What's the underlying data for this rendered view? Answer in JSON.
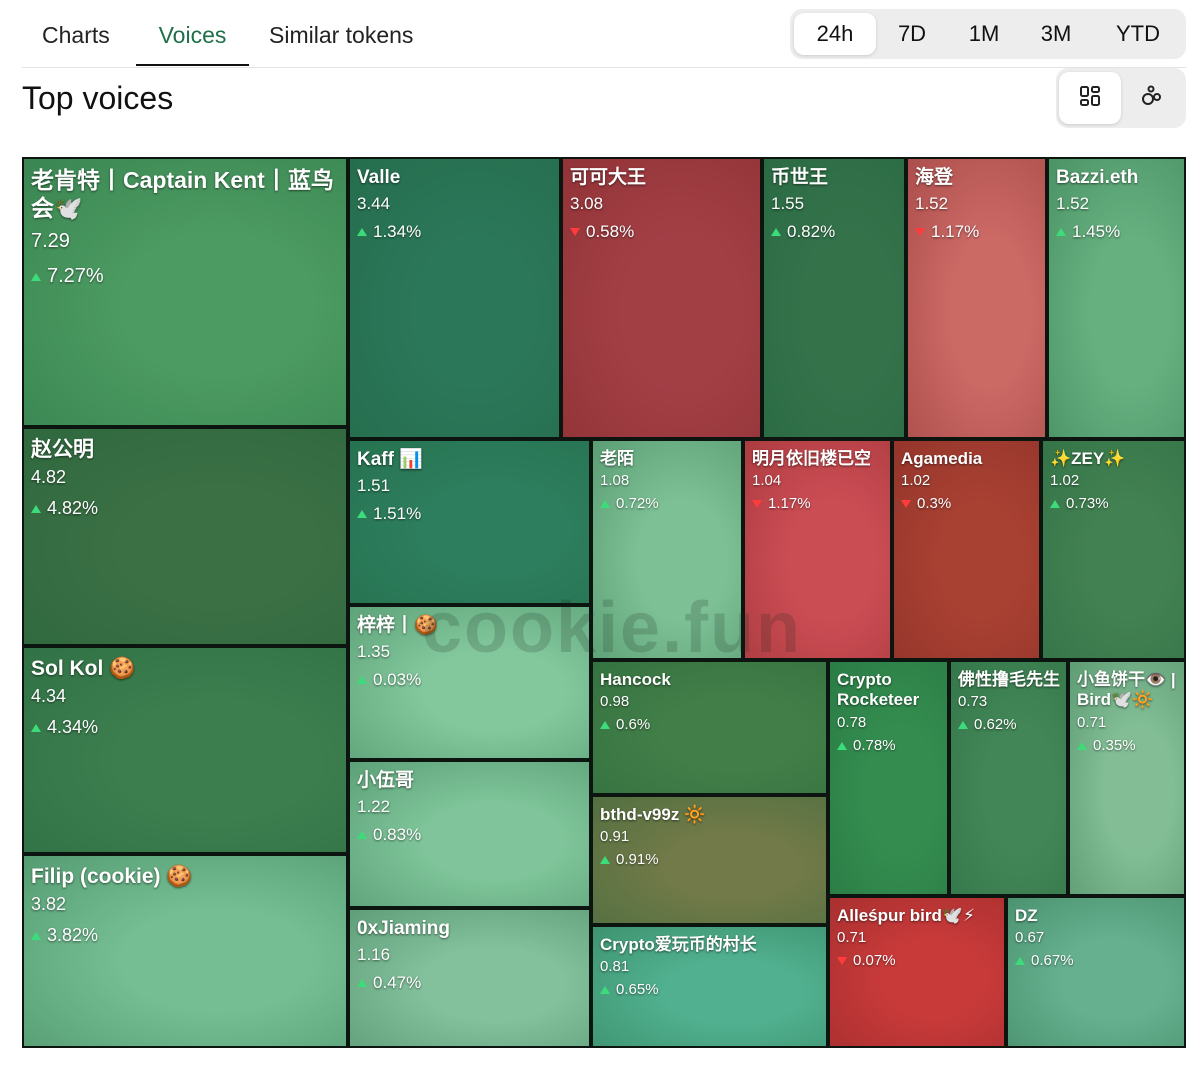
{
  "tabs": [
    {
      "label": "Charts"
    },
    {
      "label": "Voices"
    },
    {
      "label": "Similar tokens"
    }
  ],
  "time_ranges": [
    {
      "label": "24h"
    },
    {
      "label": "7D"
    },
    {
      "label": "1M"
    },
    {
      "label": "3M"
    },
    {
      "label": "YTD"
    }
  ],
  "title": "Top voices",
  "watermark": "cookie.fun",
  "voices": [
    {
      "name": "老肯特丨Captain Kent丨蓝鸟会🕊️",
      "score": "7.29",
      "change": "7.27%",
      "dir": "up",
      "art": "#6f8a64"
    },
    {
      "name": "赵公明",
      "score": "4.82",
      "change": "4.82%",
      "dir": "up",
      "art": "#4a2a22"
    },
    {
      "name": "Sol Kol 🍪",
      "score": "4.34",
      "change": "4.34%",
      "dir": "up",
      "art": "#4e4a3a"
    },
    {
      "name": "Filip (cookie) 🍪",
      "score": "3.82",
      "change": "3.82%",
      "dir": "up",
      "art": "#c9d6d0"
    },
    {
      "name": "Valle",
      "score": "3.44",
      "change": "1.34%",
      "dir": "up",
      "art": "#273a52"
    },
    {
      "name": "可可大王",
      "score": "3.08",
      "change": "0.58%",
      "dir": "down",
      "art": "#6e4c5a"
    },
    {
      "name": "币世王",
      "score": "1.55",
      "change": "0.82%",
      "dir": "up",
      "art": "#3a3030"
    },
    {
      "name": "海登",
      "score": "1.52",
      "change": "1.17%",
      "dir": "down",
      "art": "#c8a8a0"
    },
    {
      "name": "Bazzi.eth",
      "score": "1.52",
      "change": "1.45%",
      "dir": "up",
      "art": "#a8b8a6"
    },
    {
      "name": "Kaff 📊",
      "score": "1.51",
      "change": "1.51%",
      "dir": "up",
      "art": "#2b4a5c"
    },
    {
      "name": "老陌",
      "score": "1.08",
      "change": "0.72%",
      "dir": "up",
      "art": "#dcdcd6"
    },
    {
      "name": "明月依旧楼已空",
      "score": "1.04",
      "change": "1.17%",
      "dir": "down",
      "art": "#c86a7a"
    },
    {
      "name": "Agamedia",
      "score": "1.02",
      "change": "0.3%",
      "dir": "down",
      "art": "#7a5030"
    },
    {
      "name": "✨ZEY✨",
      "score": "1.02",
      "change": "0.73%",
      "dir": "up",
      "art": "#5a5040"
    },
    {
      "name": "梓梓丨🍪",
      "score": "1.35",
      "change": "0.03%",
      "dir": "up",
      "art": "#e8ece6"
    },
    {
      "name": "小伍哥",
      "score": "1.22",
      "change": "0.83%",
      "dir": "up",
      "art": "#dfe5df"
    },
    {
      "name": "0xJiaming",
      "score": "1.16",
      "change": "0.47%",
      "dir": "up",
      "art": "#e8dde4"
    },
    {
      "name": "Hancock",
      "score": "0.98",
      "change": "0.6%",
      "dir": "up",
      "art": "#5a4a2a"
    },
    {
      "name": "bthd-v99z 🔆",
      "score": "0.91",
      "change": "0.91%",
      "dir": "up",
      "art": "#c0402a"
    },
    {
      "name": "Crypto爱玩币的村长",
      "score": "0.81",
      "change": "0.65%",
      "dir": "up",
      "art": "#7ab8c8"
    },
    {
      "name": "Crypto Rocketeer",
      "score": "0.78",
      "change": "0.78%",
      "dir": "up",
      "art": "#3a6a3a"
    },
    {
      "name": "佛性撸毛先生",
      "score": "0.73",
      "change": "0.62%",
      "dir": "up",
      "art": "#5a5a4a"
    },
    {
      "name": "小鱼饼干👁️ | Bird🕊️🔆",
      "score": "0.71",
      "change": "0.35%",
      "dir": "up",
      "art": "#e6d6d6"
    },
    {
      "name": "Alleśpur bird🕊️⚡",
      "score": "0.71",
      "change": "0.07%",
      "dir": "down",
      "art": "#c04040"
    },
    {
      "name": "DZ",
      "score": "0.67",
      "change": "0.67%",
      "dir": "up",
      "art": "#a8b8c8"
    }
  ]
}
